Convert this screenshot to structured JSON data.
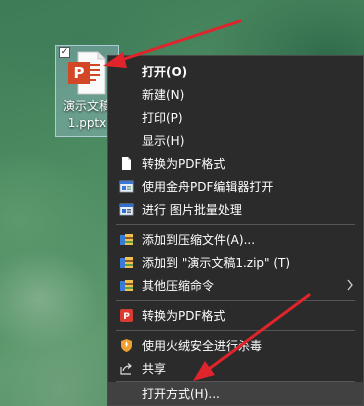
{
  "desktop": {
    "file_icon": {
      "label_line1": "演示文稿",
      "label_line2": "1.pptx",
      "check": "✓",
      "app_letter": "P"
    }
  },
  "context_menu": {
    "items": [
      {
        "label": "打开(O)",
        "icon": "none",
        "bold": true
      },
      {
        "label": "新建(N)",
        "icon": "none"
      },
      {
        "label": "打印(P)",
        "icon": "none"
      },
      {
        "label": "显示(H)",
        "icon": "none"
      },
      {
        "label": "转换为PDF格式",
        "icon": "document-icon"
      },
      {
        "label": "使用金舟PDF编辑器打开",
        "icon": "pdf-editor-icon"
      },
      {
        "label": "进行 图片批量处理",
        "icon": "image-batch-icon"
      },
      {
        "label": "添加到压缩文件(A)...",
        "icon": "archive-icon"
      },
      {
        "label": "添加到 \"演示文稿1.zip\" (T)",
        "icon": "archive-icon"
      },
      {
        "label": "其他压缩命令",
        "icon": "archive-icon",
        "submenu": true
      },
      {
        "label": "转换为PDF格式",
        "icon": "pdf-convert-icon"
      },
      {
        "label": "使用火绒安全进行杀毒",
        "icon": "shield-icon"
      },
      {
        "label": "共享",
        "icon": "share-icon"
      },
      {
        "label": "打开方式(H)...",
        "icon": "none",
        "highlighted": true
      }
    ]
  },
  "colors": {
    "menu_bg": "#2b2b2b",
    "menu_highlight": "#414141",
    "arrow": "#e0242c",
    "ppt_orange": "#d24726"
  }
}
